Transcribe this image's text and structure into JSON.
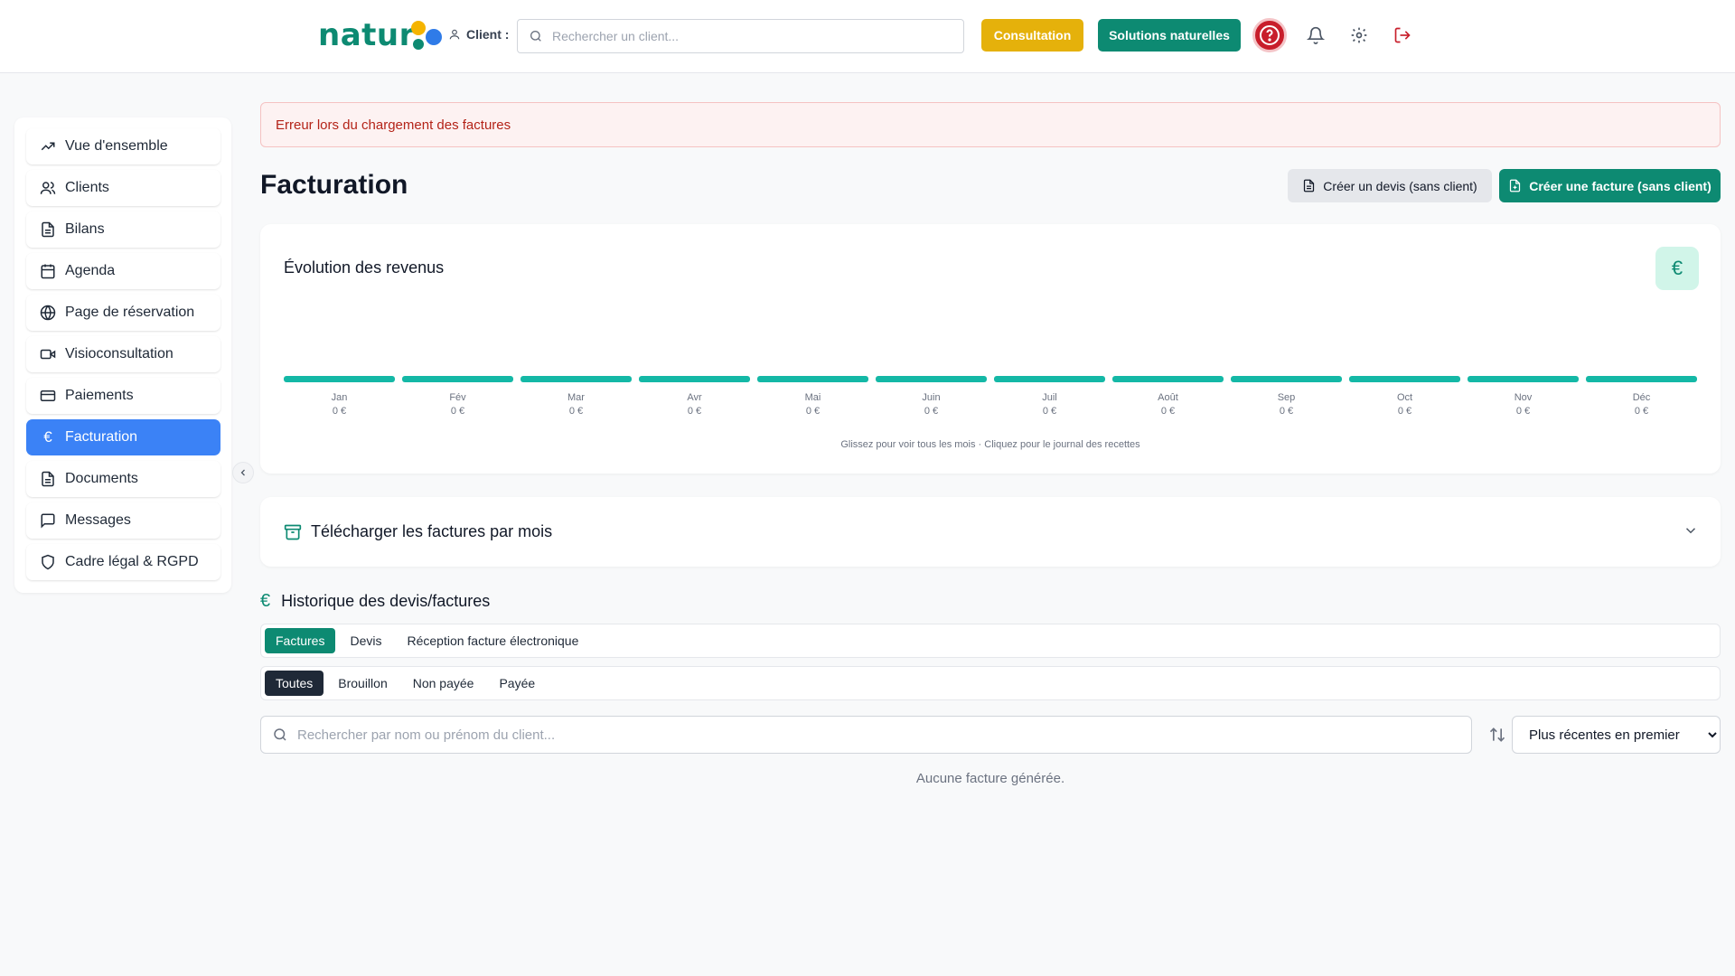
{
  "header": {
    "logo_text": "natur",
    "client_label": "Client :",
    "client_search_placeholder": "Rechercher un client...",
    "consultation_label": "Consultation",
    "solutions_label": "Solutions naturelles",
    "colors": {
      "brand_green": "#0d8a72",
      "yellow": "#e5b10b",
      "help_red": "#c81e2b"
    },
    "icons": [
      "user-icon",
      "search-icon",
      "help-icon",
      "bell-icon",
      "gear-icon",
      "logout-icon"
    ]
  },
  "sidebar": {
    "items": [
      {
        "label": "Vue d'ensemble",
        "icon": "trending-up-icon"
      },
      {
        "label": "Clients",
        "icon": "users-icon"
      },
      {
        "label": "Bilans",
        "icon": "file-icon"
      },
      {
        "label": "Agenda",
        "icon": "calendar-icon"
      },
      {
        "label": "Page de réservation",
        "icon": "globe-icon"
      },
      {
        "label": "Visioconsultation",
        "icon": "video-icon"
      },
      {
        "label": "Paiements",
        "icon": "credit-card-icon"
      },
      {
        "label": "Facturation",
        "icon": "euro-icon",
        "active": true
      },
      {
        "label": "Documents",
        "icon": "file-icon"
      },
      {
        "label": "Messages",
        "icon": "message-icon"
      },
      {
        "label": "Cadre légal & RGPD",
        "icon": "shield-icon"
      }
    ],
    "active_color": "#3b82f6"
  },
  "main": {
    "error_message": "Erreur lors du chargement des factures",
    "title": "Facturation",
    "create_devis_label": "Créer un devis (sans client)",
    "create_facture_label": "Créer une facture (sans client)",
    "revenue_card": {
      "title": "Évolution des revenus",
      "badge": "€",
      "hint": "Glissez pour voir tous les mois · Cliquez pour le journal des recettes"
    },
    "download_card": {
      "title": "Télécharger les factures par mois"
    },
    "history": {
      "title": "Historique des devis/factures",
      "type_tabs": [
        "Factures",
        "Devis",
        "Réception facture électronique"
      ],
      "active_type_tab": "Factures",
      "status_tabs": [
        "Toutes",
        "Brouillon",
        "Non payée",
        "Payée"
      ],
      "active_status_tab": "Toutes",
      "search_placeholder": "Rechercher par nom ou prénom du client...",
      "sort_value": "Plus récentes en premier",
      "empty_message": "Aucune facture générée."
    }
  },
  "chart_data": {
    "type": "bar",
    "title": "Évolution des revenus",
    "categories": [
      "Jan",
      "Fév",
      "Mar",
      "Avr",
      "Mai",
      "Juin",
      "Juil",
      "Août",
      "Sep",
      "Oct",
      "Nov",
      "Déc"
    ],
    "values": [
      0,
      0,
      0,
      0,
      0,
      0,
      0,
      0,
      0,
      0,
      0,
      0
    ],
    "value_labels": [
      "0 €",
      "0 €",
      "0 €",
      "0 €",
      "0 €",
      "0 €",
      "0 €",
      "0 €",
      "0 €",
      "0 €",
      "0 €",
      "0 €"
    ],
    "xlabel": "",
    "ylabel": "",
    "grid": false,
    "bar_color": "#14b8a6"
  }
}
